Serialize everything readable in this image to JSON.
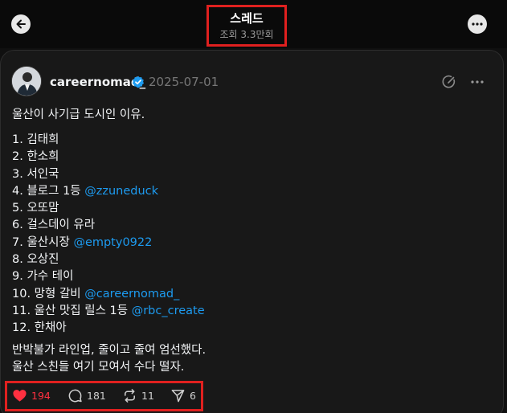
{
  "header": {
    "title": "스레드",
    "views": "조회 3.3만회"
  },
  "post": {
    "username": "careernomad_",
    "date": "2025-07-01",
    "intro": "울산이 사기급 도시인 이유.",
    "list": [
      {
        "num": "1.",
        "text": "김태희",
        "mention": ""
      },
      {
        "num": "2.",
        "text": "한소희",
        "mention": ""
      },
      {
        "num": "3.",
        "text": "서인국",
        "mention": ""
      },
      {
        "num": "4.",
        "text": "블로그 1등",
        "mention": "@zzuneduck"
      },
      {
        "num": "5.",
        "text": "오또맘",
        "mention": ""
      },
      {
        "num": "6.",
        "text": "걸스데이 유라",
        "mention": ""
      },
      {
        "num": "7.",
        "text": "울산시장",
        "mention": "@empty0922"
      },
      {
        "num": "8.",
        "text": "오상진",
        "mention": ""
      },
      {
        "num": "9.",
        "text": "가수 테이",
        "mention": ""
      },
      {
        "num": "10.",
        "text": "망형 갈비",
        "mention": "@careernomad_"
      },
      {
        "num": "11.",
        "text": "울산 맛집 릴스 1등",
        "mention": "@rbc_create"
      },
      {
        "num": "12.",
        "text": "한채아",
        "mention": ""
      }
    ],
    "outro_line1": "반박불가 라인업, 줄이고 줄여 엄선했다.",
    "outro_line2": "울산 스친들 여기 모여서 수다 떨자."
  },
  "actions": {
    "likes": "194",
    "replies": "181",
    "reposts": "11",
    "shares": "6"
  },
  "colors": {
    "background": "#101010",
    "card": "#181818",
    "mention": "#1d9bf0",
    "like": "#ff3040",
    "highlight": "#e0201f"
  }
}
